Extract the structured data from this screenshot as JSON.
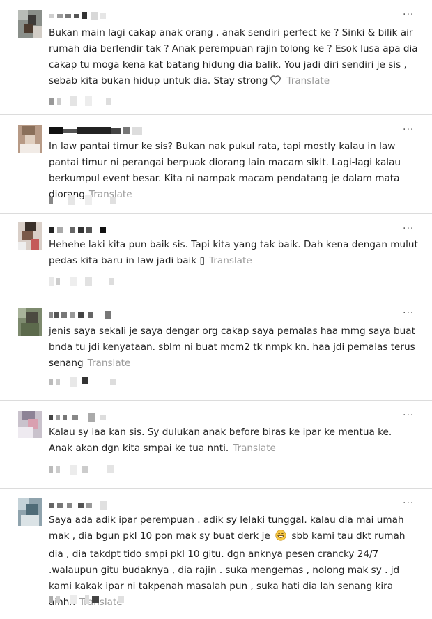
{
  "comments": [
    {
      "text": "Bukan main lagi cakap anak orang , anak sendiri perfect ke ? Sinki & bilik air rumah dia berlendir tak ? Anak perempuan rajin tolong ke ? Esok lusa apa dia cakap tu moga kena kat batang hidung dia balik. You jadi diri sendiri je sis , sebab kita bukan hidup untuk dia. Stay strong",
      "emoji_icon": "heart-outline-icon",
      "translate": "Translate",
      "more": "···"
    },
    {
      "text": "In law pantai timur ke sis? Bukan nak pukul rata, tapi mostly kalau in law pantai timur ni perangai berpuak diorang lain macam sikit. Lagi-lagi kalau berkumpul event besar. Kita ni nampak macam pendatang je dalam mata diorang",
      "translate": "Translate",
      "more": "···"
    },
    {
      "text": "Hehehe laki kita pun baik sis. Tapi kita yang tak baik. Dah kena dengan mulut pedas kita baru in law jadi baik",
      "emoji_placeholder": "▯",
      "translate": "Translate",
      "more": "···"
    },
    {
      "text": "jenis saya sekali je saya dengar org cakap saya pemalas haa mmg saya buat bnda tu jdi kenyataan. sblm ni buat mcm2 tk nmpk kn. haa jdi pemalas terus senang",
      "translate": "Translate",
      "more": "···"
    },
    {
      "text": "Kalau sy laa kan sis. Sy dulukan anak before biras ke ipar ke mentua ke. Anak akan dgn kita smpai ke tua nnti.",
      "translate": "Translate",
      "more": "···"
    },
    {
      "text_before_emoji": "Saya ada adik ipar perempuan . adik sy lelaki tunggal. kalau dia mai umah mak , dia bgun pkl 10 pon mak sy buat derk je",
      "emoji_icon": "grinning-sweat-emoji-icon",
      "text_after_emoji": "sbb kami tau dkt rumah dia , dia takdpt tido smpi pkl 10 gitu. dgn anknya pesen crancky 24/7 .walaupun gitu budaknya , dia rajin . suka mengemas , nolong mak sy . jd kami kakak ipar ni takpenah masalah pun , suka hati dia lah senang kira aihhh",
      "translate": "Translate",
      "more": "···"
    }
  ]
}
